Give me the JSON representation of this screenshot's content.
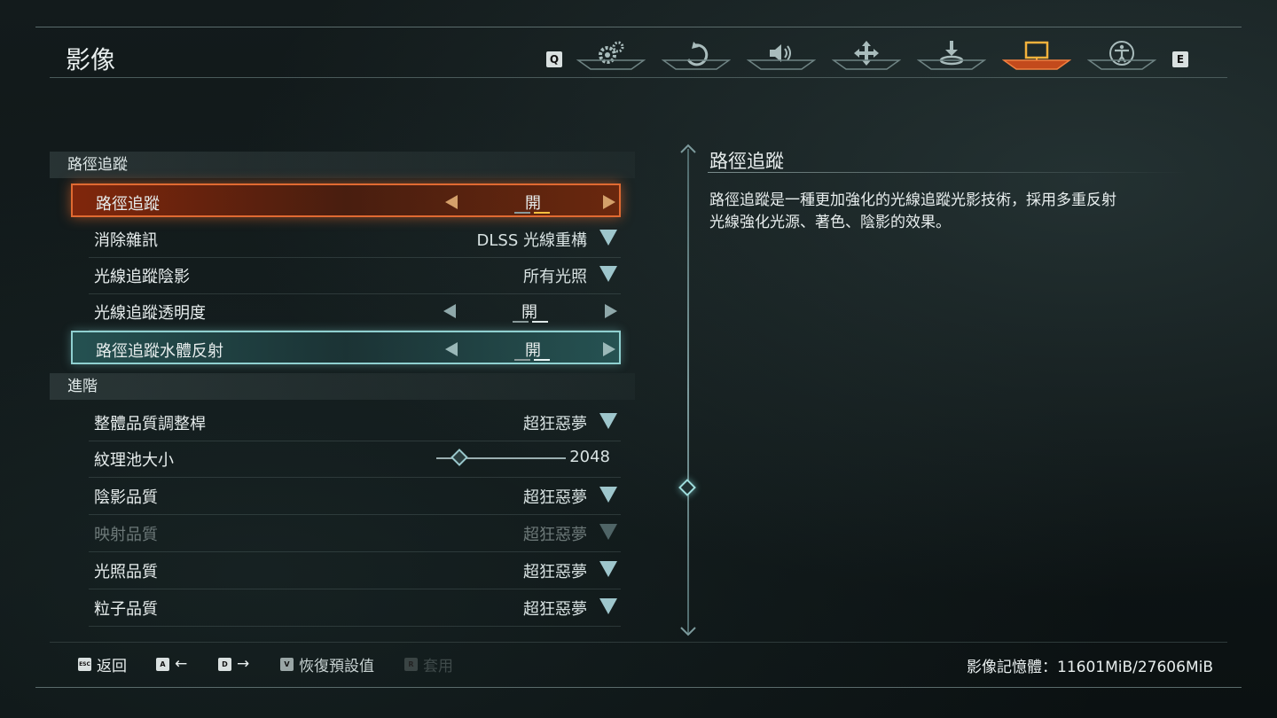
{
  "header": {
    "title": "影像",
    "key_prev": "Q",
    "key_next": "E",
    "tabs": [
      {
        "icon": "gears-icon",
        "active": false
      },
      {
        "icon": "controller-icon",
        "active": false
      },
      {
        "icon": "speaker-icon",
        "active": false
      },
      {
        "icon": "move-arrows-icon",
        "active": false
      },
      {
        "icon": "download-icon",
        "active": false
      },
      {
        "icon": "monitor-icon",
        "active": true
      },
      {
        "icon": "accessibility-icon",
        "active": false
      }
    ]
  },
  "sections": {
    "path_tracing": {
      "header": "路徑追蹤",
      "rows": [
        {
          "label": "路徑追蹤",
          "value": "開"
        },
        {
          "label": "消除雜訊",
          "value": "DLSS 光線重構"
        },
        {
          "label": "光線追蹤陰影",
          "value": "所有光照"
        },
        {
          "label": "光線追蹤透明度",
          "value": "開"
        },
        {
          "label": "路徑追蹤水體反射",
          "value": "開"
        }
      ]
    },
    "advanced": {
      "header": "進階",
      "rows": [
        {
          "label": "整體品質調整桿",
          "value": "超狂惡夢"
        },
        {
          "label": "紋理池大小",
          "value": "2048",
          "slider_fraction": 0.18
        },
        {
          "label": "陰影品質",
          "value": "超狂惡夢"
        },
        {
          "label": "映射品質",
          "value": "超狂惡夢",
          "disabled": true
        },
        {
          "label": "光照品質",
          "value": "超狂惡夢"
        },
        {
          "label": "粒子品質",
          "value": "超狂惡夢"
        }
      ]
    }
  },
  "description": {
    "title": "路徑追蹤",
    "body": "路徑追蹤是一種更加強化的光線追蹤光影技術，採用多重反射光線強化光源、著色、陰影的效果。"
  },
  "footer": {
    "back": {
      "key": "ESC",
      "label": "返回"
    },
    "left": {
      "key": "A",
      "label": "←"
    },
    "right": {
      "key": "D",
      "label": "→"
    },
    "reset": {
      "key": "V",
      "label": "恢復預設值"
    },
    "apply": {
      "key": "R",
      "label": "套用"
    },
    "memory": "影像記憶體：11601MiB/27606MiB"
  },
  "colors": {
    "accent_orange": "#e06a32",
    "accent_teal": "#8fd0d0"
  }
}
